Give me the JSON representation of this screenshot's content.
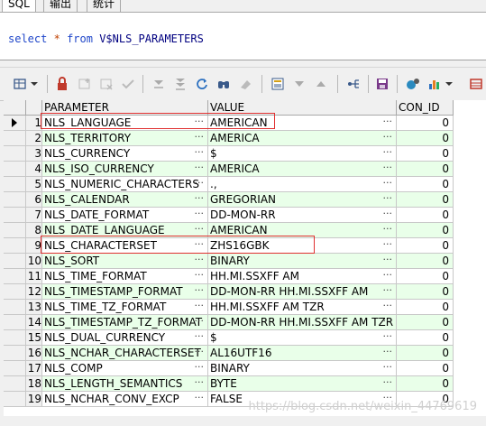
{
  "tabs": [
    {
      "label": "SQL"
    },
    {
      "label": "输出"
    },
    {
      "label": "统计"
    }
  ],
  "editor": {
    "keyword_select": "select",
    "star": "*",
    "keyword_from": "from",
    "object": "V$NLS_PARAMETERS"
  },
  "toolbar": {
    "icons": [
      "grid-options-icon",
      "lock-icon",
      "insert-record-icon",
      "delete-record-icon",
      "post-record-icon",
      "next-page-icon",
      "last-page-icon",
      "refresh-icon",
      "find-icon",
      "clear-icon",
      "query-by-example-icon",
      "sort-desc-icon",
      "sort-asc-icon",
      "export-icon",
      "save-icon",
      "connection-icon",
      "chart-icon",
      "table-view-icon"
    ]
  },
  "grid": {
    "headers": {
      "param": "PARAMETER",
      "value": "VALUE",
      "conid": "CON_ID"
    },
    "rows": [
      {
        "num": "1",
        "param": "NLS_LANGUAGE",
        "value": "AMERICAN",
        "conid": "0"
      },
      {
        "num": "2",
        "param": "NLS_TERRITORY",
        "value": "AMERICA",
        "conid": "0"
      },
      {
        "num": "3",
        "param": "NLS_CURRENCY",
        "value": "$",
        "conid": "0"
      },
      {
        "num": "4",
        "param": "NLS_ISO_CURRENCY",
        "value": "AMERICA",
        "conid": "0"
      },
      {
        "num": "5",
        "param": "NLS_NUMERIC_CHARACTERS",
        "value": ".,",
        "conid": "0"
      },
      {
        "num": "6",
        "param": "NLS_CALENDAR",
        "value": "GREGORIAN",
        "conid": "0"
      },
      {
        "num": "7",
        "param": "NLS_DATE_FORMAT",
        "value": "DD-MON-RR",
        "conid": "0"
      },
      {
        "num": "8",
        "param": "NLS_DATE_LANGUAGE",
        "value": "AMERICAN",
        "conid": "0"
      },
      {
        "num": "9",
        "param": "NLS_CHARACTERSET",
        "value": "ZHS16GBK",
        "conid": "0"
      },
      {
        "num": "10",
        "param": "NLS_SORT",
        "value": "BINARY",
        "conid": "0"
      },
      {
        "num": "11",
        "param": "NLS_TIME_FORMAT",
        "value": "HH.MI.SSXFF AM",
        "conid": "0"
      },
      {
        "num": "12",
        "param": "NLS_TIMESTAMP_FORMAT",
        "value": "DD-MON-RR HH.MI.SSXFF AM",
        "conid": "0"
      },
      {
        "num": "13",
        "param": "NLS_TIME_TZ_FORMAT",
        "value": "HH.MI.SSXFF AM TZR",
        "conid": "0"
      },
      {
        "num": "14",
        "param": "NLS_TIMESTAMP_TZ_FORMAT",
        "value": "DD-MON-RR HH.MI.SSXFF AM TZR",
        "conid": "0"
      },
      {
        "num": "15",
        "param": "NLS_DUAL_CURRENCY",
        "value": "$",
        "conid": "0"
      },
      {
        "num": "16",
        "param": "NLS_NCHAR_CHARACTERSET",
        "value": "AL16UTF16",
        "conid": "0"
      },
      {
        "num": "17",
        "param": "NLS_COMP",
        "value": "BINARY",
        "conid": "0"
      },
      {
        "num": "18",
        "param": "NLS_LENGTH_SEMANTICS",
        "value": "BYTE",
        "conid": "0"
      },
      {
        "num": "19",
        "param": "NLS_NCHAR_CONV_EXCP",
        "value": "FALSE",
        "conid": "0"
      }
    ],
    "ellipsis": "···"
  },
  "watermark": "https://blog.csdn.net/weixin_44769619",
  "colors": {
    "keyword": "#1f46c9",
    "alt_row": "#e9ffe9",
    "highlight": "#e03030"
  }
}
